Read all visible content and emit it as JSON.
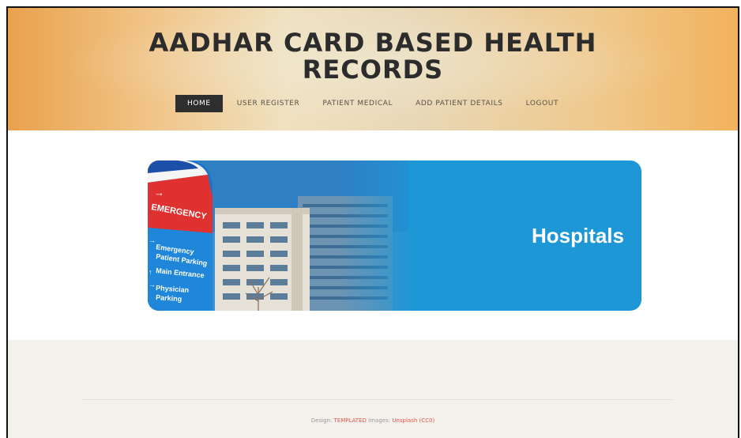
{
  "site": {
    "title_line1": "AADHAR CARD BASED HEALTH",
    "title_line2": "RECORDS"
  },
  "nav": {
    "items": [
      {
        "label": "HOME",
        "active": true
      },
      {
        "label": "USER REGISTER",
        "active": false
      },
      {
        "label": "PATIENT MEDICAL",
        "active": false
      },
      {
        "label": "ADD PATIENT DETAILS",
        "active": false
      },
      {
        "label": "LOGOUT",
        "active": false
      }
    ]
  },
  "banner": {
    "title": "Hospitals",
    "sign_header": "EMERGENCY",
    "sign_lines": [
      "Emergency",
      "Patient Parking",
      "Main Entrance",
      "Physician",
      "Parking"
    ]
  },
  "footer": {
    "design_label": "Design:",
    "design_link": "TEMPLATED",
    "images_label": "Images:",
    "images_link": "Unsplash (CC0)"
  },
  "colors": {
    "accent_link": "#e0564c",
    "nav_active_bg": "#2e2e2e",
    "banner_blue": "#1e97d6",
    "footer_bg": "#f3f1ec"
  }
}
